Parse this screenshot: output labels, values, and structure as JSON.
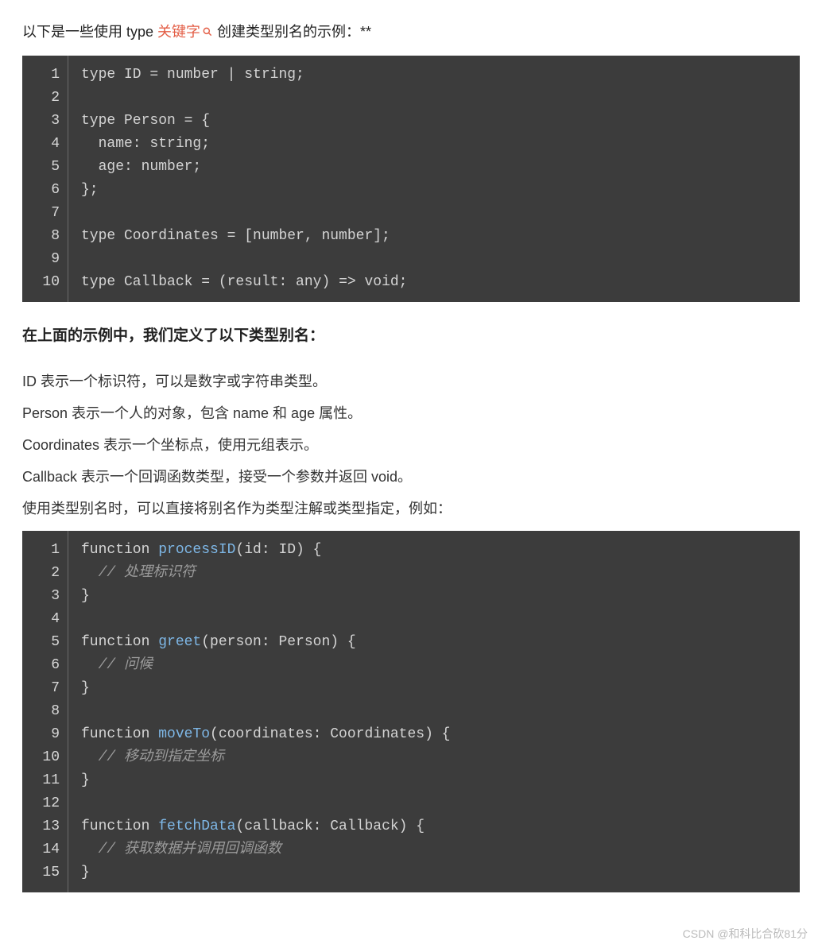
{
  "intro": {
    "prefix": "以下是一些使用 type ",
    "link_text": "关键字",
    "suffix": " 创建类型别名的示例：**"
  },
  "code1": {
    "lines": [
      [
        {
          "t": "type ID = number | string;",
          "c": ""
        }
      ],
      [
        {
          "t": "",
          "c": ""
        }
      ],
      [
        {
          "t": "type Person = {",
          "c": ""
        }
      ],
      [
        {
          "t": "  name: string;",
          "c": ""
        }
      ],
      [
        {
          "t": "  age: number;",
          "c": ""
        }
      ],
      [
        {
          "t": "};",
          "c": ""
        }
      ],
      [
        {
          "t": "",
          "c": ""
        }
      ],
      [
        {
          "t": "type Coordinates = [number, number];",
          "c": ""
        }
      ],
      [
        {
          "t": "",
          "c": ""
        }
      ],
      [
        {
          "t": "type Callback = (result: any) ",
          "c": ""
        },
        {
          "t": "=>",
          "c": "arrow"
        },
        {
          "t": " void;",
          "c": ""
        }
      ]
    ]
  },
  "heading": "在上面的示例中，我们定义了以下类型别名：",
  "desc": [
    "ID 表示一个标识符，可以是数字或字符串类型。",
    "Person 表示一个人的对象，包含 name 和 age 属性。",
    "Coordinates 表示一个坐标点，使用元组表示。",
    "Callback 表示一个回调函数类型，接受一个参数并返回 void。",
    "使用类型别名时，可以直接将别名作为类型注解或类型指定，例如："
  ],
  "code2": {
    "lines": [
      [
        {
          "t": "function ",
          "c": ""
        },
        {
          "t": "processID",
          "c": "fn"
        },
        {
          "t": "(id: ID) {",
          "c": ""
        }
      ],
      [
        {
          "t": "  // 处理标识符",
          "c": "cm"
        }
      ],
      [
        {
          "t": "}",
          "c": ""
        }
      ],
      [
        {
          "t": "",
          "c": ""
        }
      ],
      [
        {
          "t": "function ",
          "c": ""
        },
        {
          "t": "greet",
          "c": "fn"
        },
        {
          "t": "(person: Person) {",
          "c": ""
        }
      ],
      [
        {
          "t": "  // 问候",
          "c": "cm"
        }
      ],
      [
        {
          "t": "}",
          "c": ""
        }
      ],
      [
        {
          "t": "",
          "c": ""
        }
      ],
      [
        {
          "t": "function ",
          "c": ""
        },
        {
          "t": "moveTo",
          "c": "fn"
        },
        {
          "t": "(coordinates: Coordinates) {",
          "c": ""
        }
      ],
      [
        {
          "t": "  // 移动到指定坐标",
          "c": "cm"
        }
      ],
      [
        {
          "t": "}",
          "c": ""
        }
      ],
      [
        {
          "t": "",
          "c": ""
        }
      ],
      [
        {
          "t": "function ",
          "c": ""
        },
        {
          "t": "fetchData",
          "c": "fn"
        },
        {
          "t": "(callback: Callback) {",
          "c": ""
        }
      ],
      [
        {
          "t": "  // 获取数据并调用回调函数",
          "c": "cm"
        }
      ],
      [
        {
          "t": "}",
          "c": ""
        }
      ]
    ]
  },
  "watermark": "CSDN @和科比合砍81分"
}
